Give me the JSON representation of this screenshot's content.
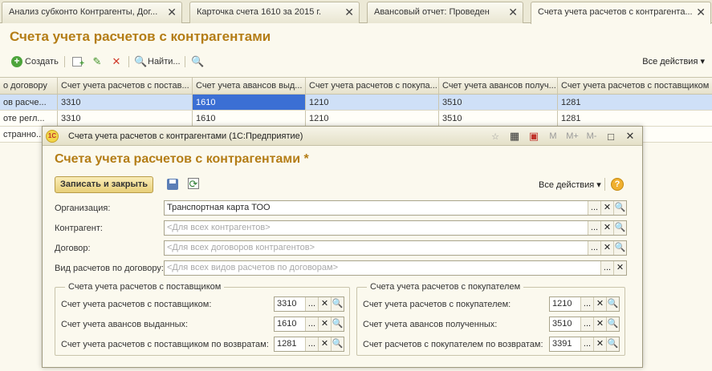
{
  "tabs": [
    {
      "label": "Анализ субконто Контрагенты, Дог..."
    },
    {
      "label": "Карточка счета 1610  за 2015 г."
    },
    {
      "label": "Авансовый отчет: Проведен"
    },
    {
      "label": "Счета учета расчетов с контрагента..."
    }
  ],
  "main": {
    "title": "Счета учета расчетов с контрагентами",
    "toolbar": {
      "create_label": "Создать",
      "find_label": "Найти...",
      "all_actions": "Все действия ▾"
    },
    "grid": {
      "columns": [
        "о договору",
        "Счет учета расчетов с постав...",
        "Счет учета авансов выд...",
        "Счет учета расчетов с покупа...",
        "Счет учета авансов получ...",
        "Счет учета расчетов с поставщиком п"
      ],
      "rows": [
        [
          "ов расче...",
          "3310",
          "1610",
          "1210",
          "3510",
          "1281"
        ],
        [
          "оте регл...",
          "3310",
          "1610",
          "1210",
          "3510",
          "1281"
        ],
        [
          "странно...",
          "",
          "",
          "",
          "",
          ""
        ]
      ]
    }
  },
  "dialog": {
    "caption": "Счета учета расчетов с контрагентами  (1С:Предприятие)",
    "app_logo": "1С",
    "title_buttons": {
      "m": "M",
      "mplus": "M+",
      "mminus": "M-",
      "minimize": "□",
      "close": "✕"
    },
    "title": "Счета учета расчетов с контрагентами *",
    "save_close_label": "Записать и закрыть",
    "all_actions": "Все действия ▾",
    "help_label": "?",
    "fields": {
      "organization": {
        "label": "Организация:",
        "value": "Транспортная карта ТОО"
      },
      "counterparty": {
        "label": "Контрагент:",
        "placeholder": "<Для всех контрагентов>"
      },
      "contract": {
        "label": "Договор:",
        "placeholder": "<Для всех договоров контрагентов>"
      },
      "settlement_type": {
        "label": "Вид расчетов по договору:",
        "placeholder": "<Для всех видов расчетов по договорам>"
      }
    },
    "supplier_group": {
      "title": "Счета учета расчетов с поставщиком",
      "rows": [
        {
          "label": "Счет учета расчетов с поставщиком:",
          "value": "3310"
        },
        {
          "label": "Счет учета авансов выданных:",
          "value": "1610"
        },
        {
          "label": "Счет учета расчетов с поставщиком по возвратам:",
          "value": "1281"
        }
      ]
    },
    "customer_group": {
      "title": "Счета учета расчетов с покупателем",
      "rows": [
        {
          "label": "Счет учета расчетов с покупателем:",
          "value": "1210"
        },
        {
          "label": "Счет учета авансов полученных:",
          "value": "3510"
        },
        {
          "label": "Счет расчетов с покупателем по возвратам:",
          "value": "3391"
        }
      ]
    },
    "field_buttons": {
      "select": "...",
      "clear": "✕",
      "open": "🔍"
    }
  }
}
